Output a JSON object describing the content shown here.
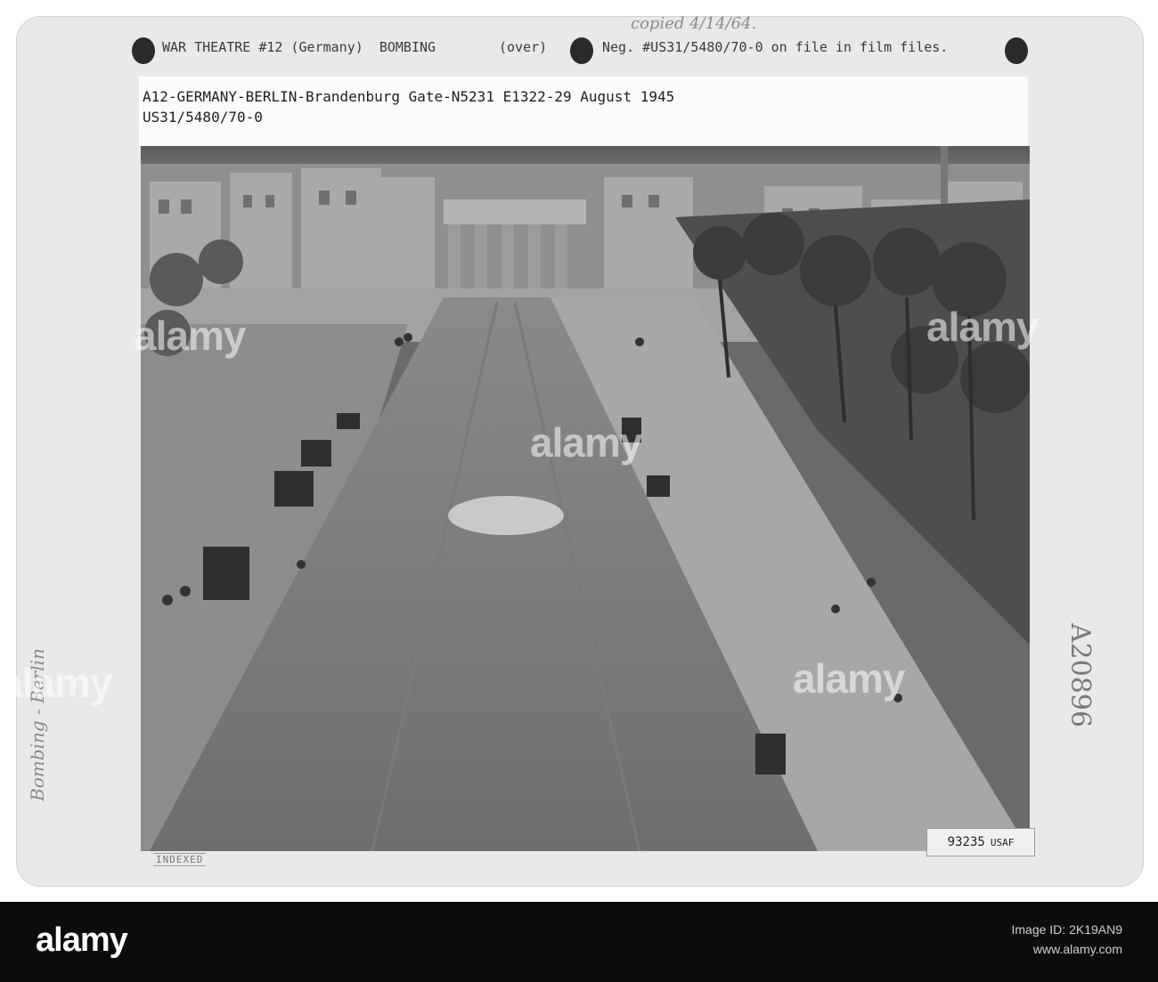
{
  "header": {
    "war_theatre": "WAR THEATRE #12 (Germany)  BOMBING",
    "over": "(over)",
    "neg_note": "Neg. #US31/5480/70-0 on file in film files.",
    "copied_note": "copied 4/14/64."
  },
  "caption": {
    "line1": "A12-GERMANY-BERLIN-Brandenburg Gate-N5231 E1322-29 August 1945",
    "line2": "US31/5480/70-0"
  },
  "side_notes": {
    "left_handwriting": "Bombing - Berlin",
    "right_number": "A20896"
  },
  "stamp": {
    "number": "93235",
    "agency": "USAF"
  },
  "indexed_mark": "INDEXED",
  "watermark": {
    "text": "alamy"
  },
  "footer": {
    "logo": "alamy",
    "image_id_label": "Image ID: 2K19AN9",
    "url": "www.alamy.com"
  }
}
